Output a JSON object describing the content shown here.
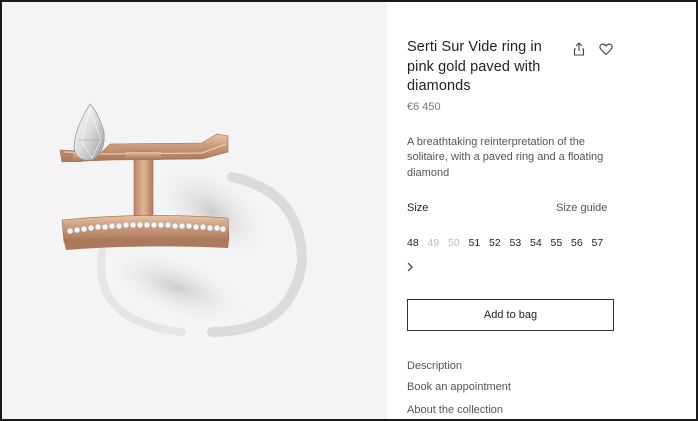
{
  "product": {
    "title": "Serti Sur Vide ring in pink gold paved with diamonds",
    "price": "€6 450",
    "description": "A breathtaking reinterpretation of the solitaire, with a paved ring and a floating diamond"
  },
  "size": {
    "label": "Size",
    "guide_label": "Size guide",
    "options": [
      {
        "label": "48",
        "available": true
      },
      {
        "label": "49",
        "available": false
      },
      {
        "label": "50",
        "available": false
      },
      {
        "label": "51",
        "available": true
      },
      {
        "label": "52",
        "available": true
      },
      {
        "label": "53",
        "available": true
      },
      {
        "label": "54",
        "available": true
      },
      {
        "label": "55",
        "available": true
      },
      {
        "label": "56",
        "available": true
      },
      {
        "label": "57",
        "available": true
      }
    ]
  },
  "actions": {
    "add_to_bag": "Add to bag"
  },
  "links": {
    "description": "Description",
    "book_appointment": "Book an appointment",
    "about_collection": "About the collection"
  },
  "icons": {
    "share": "share-icon",
    "wishlist": "heart-icon",
    "next": "chevron-right-icon"
  },
  "colors": {
    "image_background": "#f4f4f4",
    "pink_gold": "#c9997a",
    "text_primary": "#1f1f1f",
    "text_secondary": "#555555",
    "size_unavailable": "#bbbbbb"
  }
}
